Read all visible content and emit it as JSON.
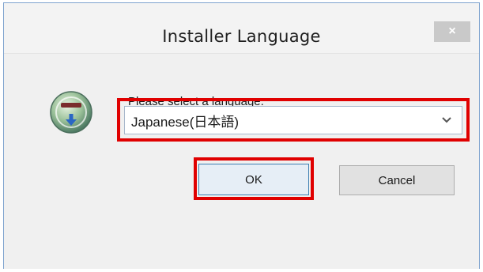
{
  "window": {
    "title": "Installer Language",
    "close_label": "×"
  },
  "dialog": {
    "prompt": "Please select a language.",
    "language_select": {
      "selected": "Japanese(日本語)"
    },
    "buttons": {
      "ok_label": "OK",
      "cancel_label": "Cancel"
    }
  },
  "icons": {
    "app": "installer-globe-icon",
    "dropdown": "chevron-down-icon",
    "close": "close-icon"
  },
  "colors": {
    "highlight": "#e00000",
    "window_border": "#7fa3cf",
    "close_button": "#c9c9c9",
    "ok_border": "#3c7fb1"
  }
}
